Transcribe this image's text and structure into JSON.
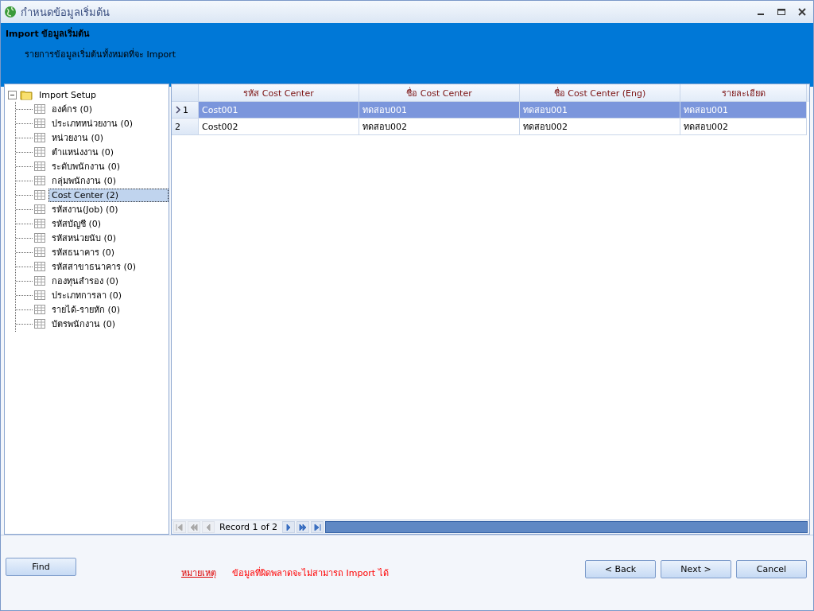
{
  "window": {
    "title": "กำหนดข้อมูลเริ่มต้น"
  },
  "header": {
    "title": "Import ข้อมูลเริ่มต้น",
    "subtitle": "รายการข้อมูลเริ่มต้นทั้งหมดที่จะ Import"
  },
  "tree": {
    "label": "Import Setup",
    "expanded": true,
    "children": [
      {
        "label": "องค์กร (0)",
        "selected": false
      },
      {
        "label": "ประเภทหน่วยงาน (0)",
        "selected": false
      },
      {
        "label": "หน่วยงาน (0)",
        "selected": false
      },
      {
        "label": "ตำแหน่งงาน (0)",
        "selected": false
      },
      {
        "label": "ระดับพนักงาน (0)",
        "selected": false
      },
      {
        "label": "กลุ่มพนักงาน (0)",
        "selected": false
      },
      {
        "label": "Cost Center (2)",
        "selected": true
      },
      {
        "label": "รหัสงาน(Job) (0)",
        "selected": false
      },
      {
        "label": "รหัสบัญชี (0)",
        "selected": false
      },
      {
        "label": "รหัสหน่วยนับ (0)",
        "selected": false
      },
      {
        "label": "รหัสธนาคาร (0)",
        "selected": false
      },
      {
        "label": "รหัสสาขาธนาคาร (0)",
        "selected": false
      },
      {
        "label": "กองทุนสำรอง (0)",
        "selected": false
      },
      {
        "label": "ประเภทการลา (0)",
        "selected": false
      },
      {
        "label": "รายได้-รายหัก (0)",
        "selected": false
      },
      {
        "label": "บัตรพนักงาน (0)",
        "selected": false
      }
    ]
  },
  "table": {
    "columns": [
      "รหัส Cost Center",
      "ชื่อ Cost Center",
      "ชื่อ Cost Center (Eng)",
      "รายละเอียด"
    ],
    "rows": [
      {
        "number": "1",
        "selected": true,
        "cells": [
          "Cost001",
          "ทดสอบ001",
          "ทดสอบ001",
          "ทดสอบ001"
        ]
      },
      {
        "number": "2",
        "selected": false,
        "cells": [
          "Cost002",
          "ทดสอบ002",
          "ทดสอบ002",
          "ทดสอบ002"
        ]
      }
    ]
  },
  "navigator": {
    "record": "Record 1 of 2",
    "buttons": [
      {
        "kind": "first",
        "disabled": true
      },
      {
        "kind": "prev-page",
        "disabled": true
      },
      {
        "kind": "prev",
        "disabled": true
      },
      {
        "kind": "next",
        "disabled": false
      },
      {
        "kind": "next-page",
        "disabled": false
      },
      {
        "kind": "last",
        "disabled": false
      }
    ]
  },
  "footer": {
    "find": "Find",
    "note_link": "หมายเหตุ",
    "note": "ข้อมูลที่ผิดพลาดจะไม่สามารถ Import ได้",
    "buttons": [
      "< Back",
      "Next >",
      "Cancel"
    ]
  }
}
